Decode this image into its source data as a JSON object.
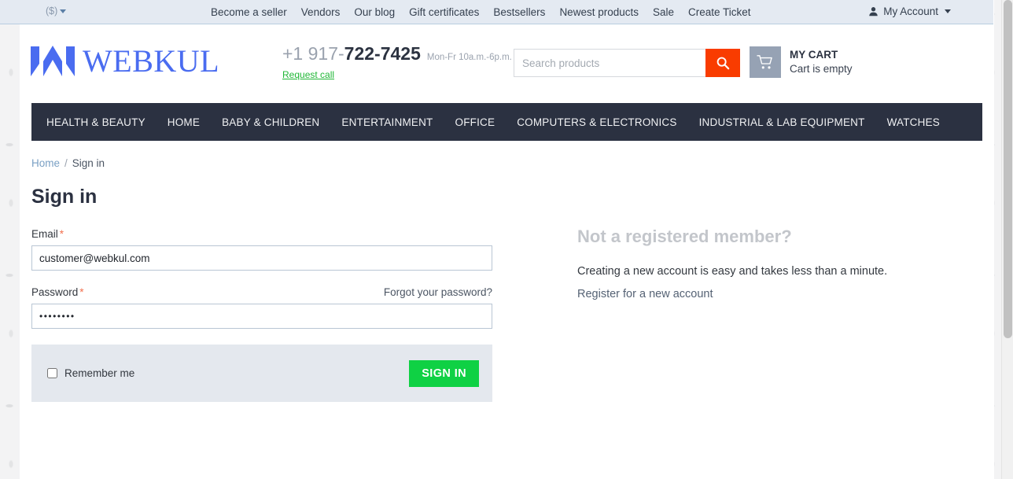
{
  "topbar": {
    "currency": "($)",
    "links": [
      "Become a seller",
      "Vendors",
      "Our blog",
      "Gift certificates",
      "Bestsellers",
      "Newest products",
      "Sale",
      "Create Ticket"
    ],
    "account_label": "My Account",
    "account_icon": "user-icon",
    "caret_icon": "chevron-down-icon"
  },
  "header": {
    "logo_text": "WEBKUL",
    "logo_icon": "webkul-logo-mark",
    "phone_prefix": "+1 917-",
    "phone_number": "722-7425",
    "hours": "Mon-Fr 10a.m.-6p.m.",
    "request_call": "Request call",
    "search": {
      "placeholder": "Search products",
      "value": "",
      "button_icon": "search-icon"
    },
    "cart": {
      "icon": "shopping-cart-icon",
      "title": "MY CART",
      "status": "Cart is empty"
    }
  },
  "nav": {
    "items": [
      "HEALTH & BEAUTY",
      "HOME",
      "BABY & CHILDREN",
      "ENTERTAINMENT",
      "OFFICE",
      "COMPUTERS & ELECTRONICS",
      "INDUSTRIAL & LAB EQUIPMENT",
      "WATCHES"
    ]
  },
  "breadcrumb": {
    "home": "Home",
    "separator": "/",
    "current": "Sign in"
  },
  "page": {
    "title": "Sign in"
  },
  "form": {
    "email_label": "Email",
    "email_value": "customer@webkul.com",
    "email_placeholder": "",
    "password_label": "Password",
    "password_value": "••••••••",
    "password_placeholder": "",
    "required_mark": "*",
    "forgot_password": "Forgot your password?",
    "remember_label": "Remember me",
    "submit_label": "SIGN IN"
  },
  "register": {
    "title": "Not a registered member?",
    "text": "Creating a new account is easy and takes less than a minute.",
    "link": "Register for a new account"
  },
  "colors": {
    "nav_bg": "#2b3141",
    "search_button": "#f93c00",
    "signin_button": "#0fd144",
    "logo_blue": "#4a6cf0",
    "request_call_green": "#21b737",
    "topbar_bg": "#e4eaf2",
    "required_star": "#f2704e"
  }
}
